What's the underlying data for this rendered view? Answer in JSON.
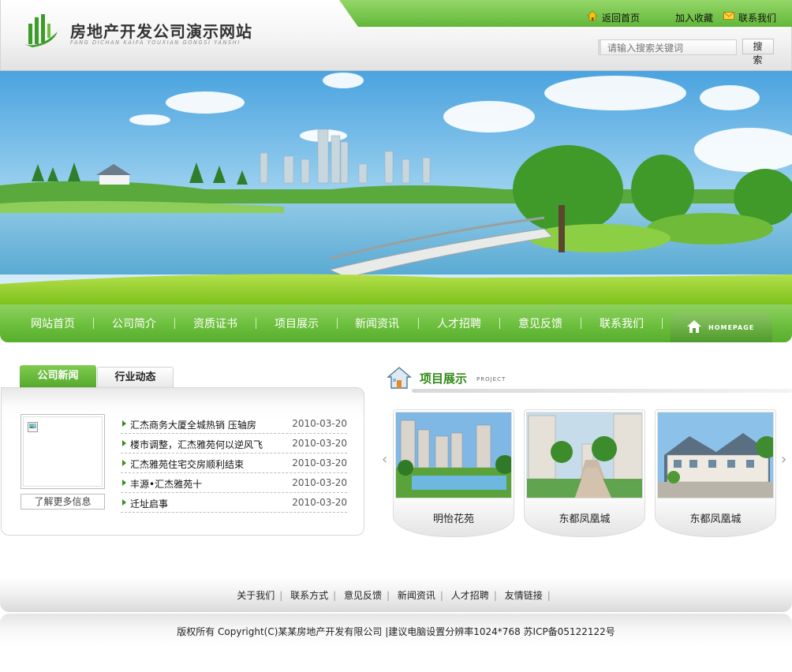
{
  "header": {
    "site_title": "房地产开发公司演示网站",
    "site_subtitle": "FANG DICHAN KAIFA YOUXIAN GONGSI YANSHI",
    "top_links": {
      "home": "返回首页",
      "favorite": "加入收藏",
      "contact": "联系我们"
    },
    "search": {
      "placeholder": "请输入搜索关键词",
      "button": "搜 索"
    }
  },
  "nav": {
    "items": [
      "网站首页",
      "公司简介",
      "资质证书",
      "项目展示",
      "新闻资讯",
      "人才招聘",
      "意见反馈",
      "联系我们"
    ],
    "homepage_label": "HOMEPAGE"
  },
  "news": {
    "tabs": [
      "公司新闻",
      "行业动态"
    ],
    "more_label": "了解更多信息",
    "items": [
      {
        "title": "汇杰商务大厦全城热销 压轴房",
        "date": "2010-03-20"
      },
      {
        "title": "楼市调整，汇杰雅苑何以逆风飞",
        "date": "2010-03-20"
      },
      {
        "title": "汇杰雅苑住宅交房顺利结束",
        "date": "2010-03-20"
      },
      {
        "title": "丰源•汇杰雅苑十",
        "date": "2010-03-20"
      },
      {
        "title": "迁址启事",
        "date": "2010-03-20"
      }
    ]
  },
  "projects": {
    "title": "项目展示",
    "subtitle": "PROJECT",
    "items": [
      {
        "name": "明怡花苑"
      },
      {
        "name": "东都凤凰城"
      },
      {
        "name": "东都凤凰城"
      }
    ]
  },
  "footer": {
    "links": [
      "关于我们",
      "联系方式",
      "意见反馈",
      "新闻资讯",
      "人才招聘",
      "友情链接"
    ],
    "copyright": "版权所有 Copyright(C)某某房地产开发有限公司 |建议电脑设置分辨率1024*768 苏ICP备05122122号"
  },
  "colors": {
    "brand_green": "#62b73a",
    "title_green": "#2f8a17"
  }
}
